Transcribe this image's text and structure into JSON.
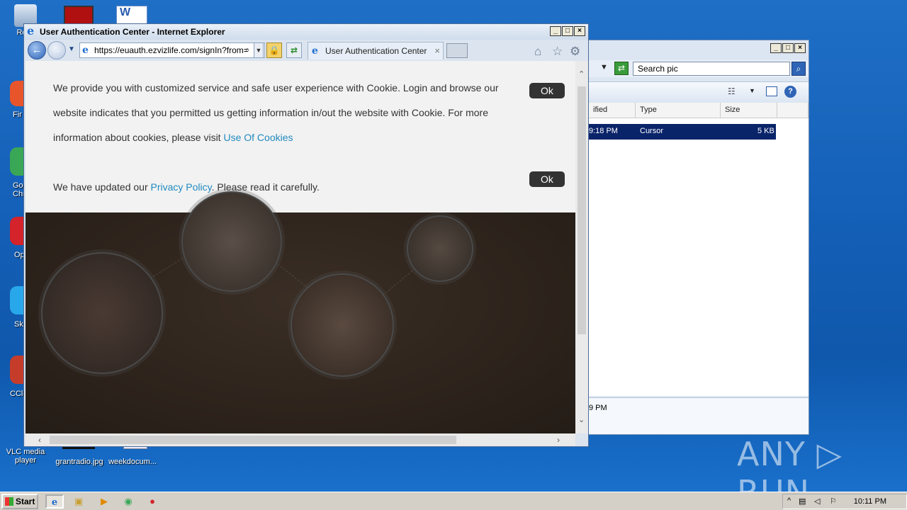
{
  "desktop": {
    "icons": [
      {
        "label": "Recy"
      },
      {
        "label": "Fir"
      },
      {
        "label": "Go\nChr"
      },
      {
        "label": "Op"
      },
      {
        "label": "Sk"
      },
      {
        "label": "CCle"
      },
      {
        "label": "VLC media player"
      },
      {
        "label": "grantradio.jpg"
      },
      {
        "label": "weekdocum..."
      }
    ]
  },
  "explorer": {
    "search_placeholder": "Search pic",
    "columns": [
      "ified",
      "Type",
      "Size"
    ],
    "row": {
      "modified": "9:18 PM",
      "type": "Cursor",
      "size": "5 KB"
    },
    "details_time": "9 PM"
  },
  "ie": {
    "title": "User Authentication Center - Internet Explorer",
    "url": "https://euauth.ezvizlife.com/signIn?from=",
    "tab_label": "User Authentication Center",
    "cookie_notice": {
      "line1": "We provide you with customized service and safe user experience with Cookie. Login and browse our",
      "line2": "website indicates that you permitted us getting information in/out the website with Cookie. For more",
      "line3_prefix": "information about cookies, please visit ",
      "line3_link": "Use Of Cookies",
      "ok": "Ok"
    },
    "privacy_notice": {
      "prefix": "We have updated our ",
      "link": "Privacy Policy",
      "suffix": ". Please read it carefully.",
      "ok": "Ok"
    }
  },
  "taskbar": {
    "start": "Start",
    "time": "10:11 PM"
  },
  "watermark": "ANY ▷ RUN"
}
